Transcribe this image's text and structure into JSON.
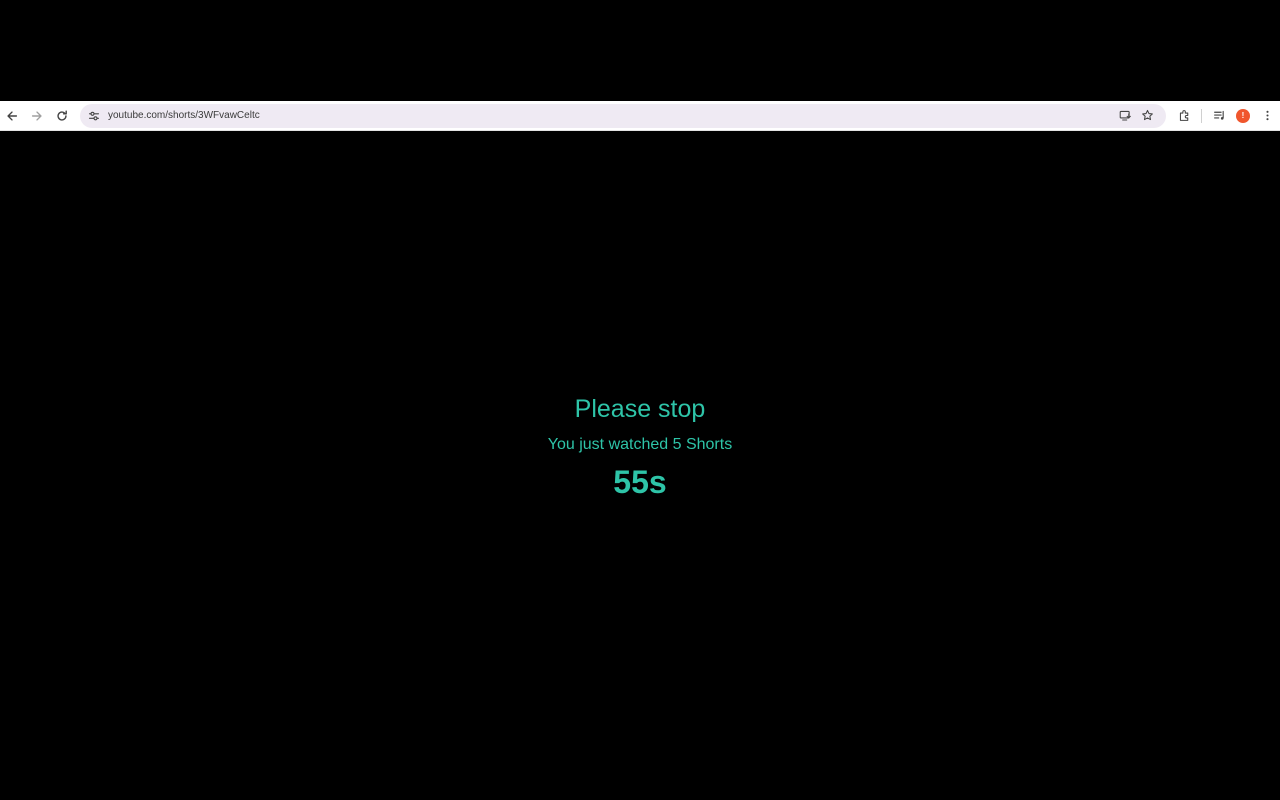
{
  "browser": {
    "url": "youtube.com/shorts/3WFvawCeltc",
    "icons": {
      "back": "back-arrow-icon",
      "forward": "forward-arrow-icon",
      "reload": "reload-icon",
      "site_info": "tune-icon",
      "install": "install-app-icon",
      "bookmark": "star-icon",
      "extensions": "puzzle-icon",
      "media": "media-queue-icon",
      "menu": "kebab-menu-icon"
    },
    "profile": {
      "initial": "!",
      "color": "#f0562d"
    }
  },
  "overlay": {
    "title": "Please stop",
    "subtitle": "You just watched 5 Shorts",
    "timer": "55s",
    "text_color": "#2ec4a8"
  }
}
